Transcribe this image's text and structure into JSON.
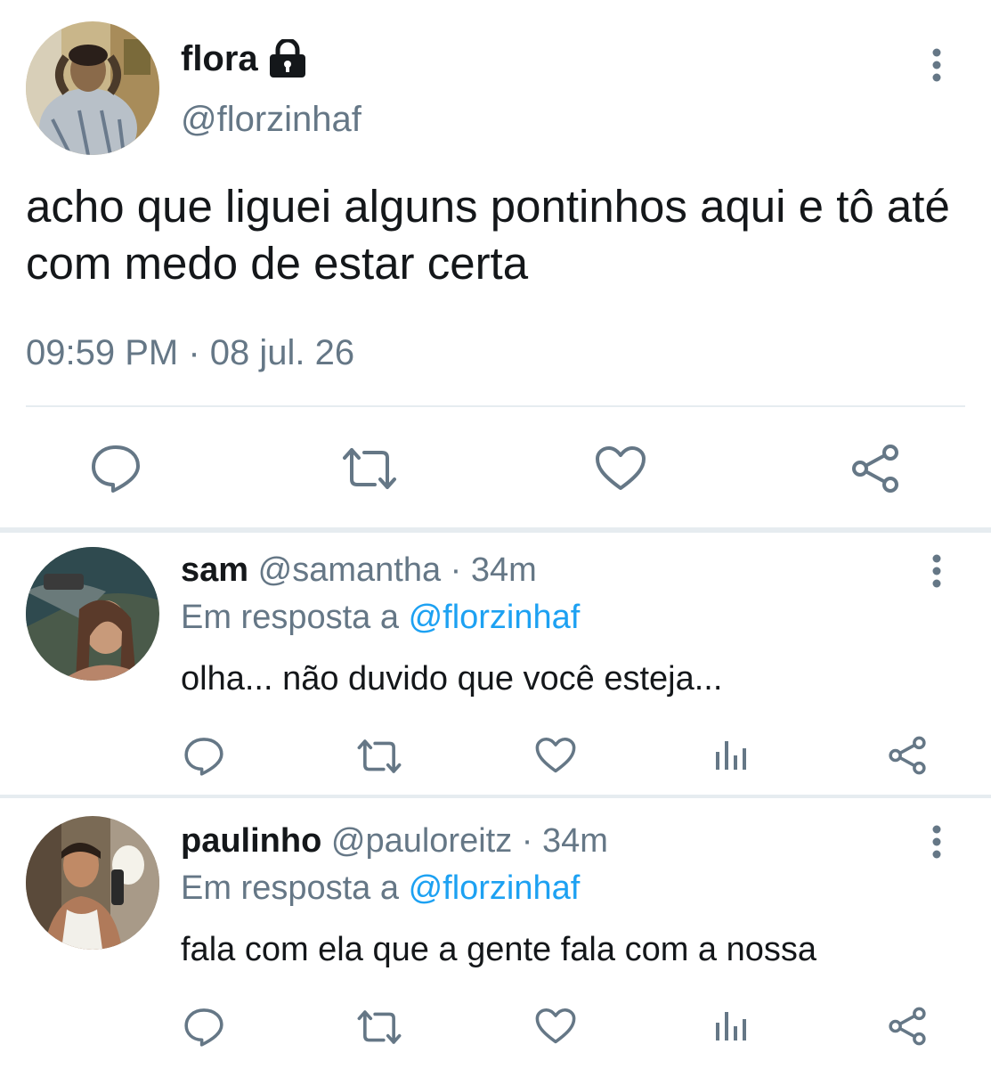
{
  "main_tweet": {
    "name": "flora",
    "handle": "@florzinhaf",
    "text": "acho que liguei alguns pontinhos aqui e tô até com medo de estar certa",
    "time": "09:59 PM",
    "separator": " · ",
    "date": "08 jul. 26",
    "icons": [
      "lock-icon",
      "more-icon",
      "reply-icon",
      "retweet-icon",
      "like-icon",
      "share-icon"
    ]
  },
  "replies": [
    {
      "name": "sam",
      "handle": "@samantha",
      "separator": " · ",
      "time": "34m",
      "in_reply_prefix": "Em resposta a ",
      "in_reply_mention": "@florzinhaf",
      "text": "olha... não duvido que você esteja..."
    },
    {
      "name": "paulinho",
      "handle": "@pauloreitz",
      "separator": " · ",
      "time": "34m",
      "in_reply_prefix": "Em resposta a ",
      "in_reply_mention": "@florzinhaf",
      "text": "fala com ela que a gente fala com a nossa"
    }
  ],
  "colors": {
    "text": "#14171a",
    "secondary": "#657786",
    "link": "#1da1f2",
    "divider": "#e6ecf0"
  }
}
